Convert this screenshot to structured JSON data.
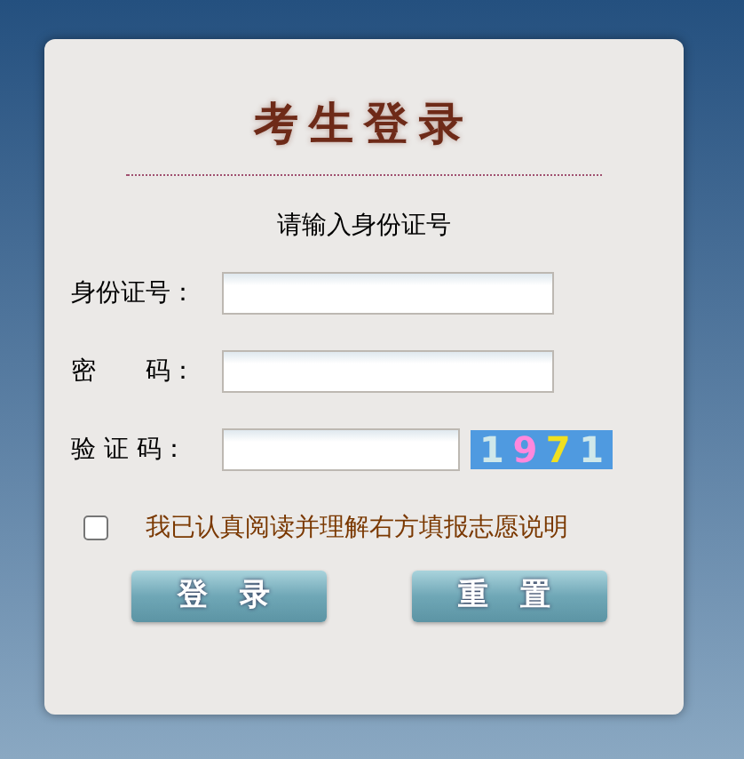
{
  "title": "考生登录",
  "subtitle": "请输入身份证号",
  "fields": [
    {
      "label": "身份证号：",
      "kind": "text"
    },
    {
      "label": "密　　码：",
      "kind": "password"
    },
    {
      "label": "验 证 码：",
      "kind": "captcha",
      "captcha": "1971"
    }
  ],
  "agreement": {
    "checked": false,
    "text": "我已认真阅读并理解右方填报志愿说明"
  },
  "buttons": [
    "登 录",
    "重 置"
  ]
}
